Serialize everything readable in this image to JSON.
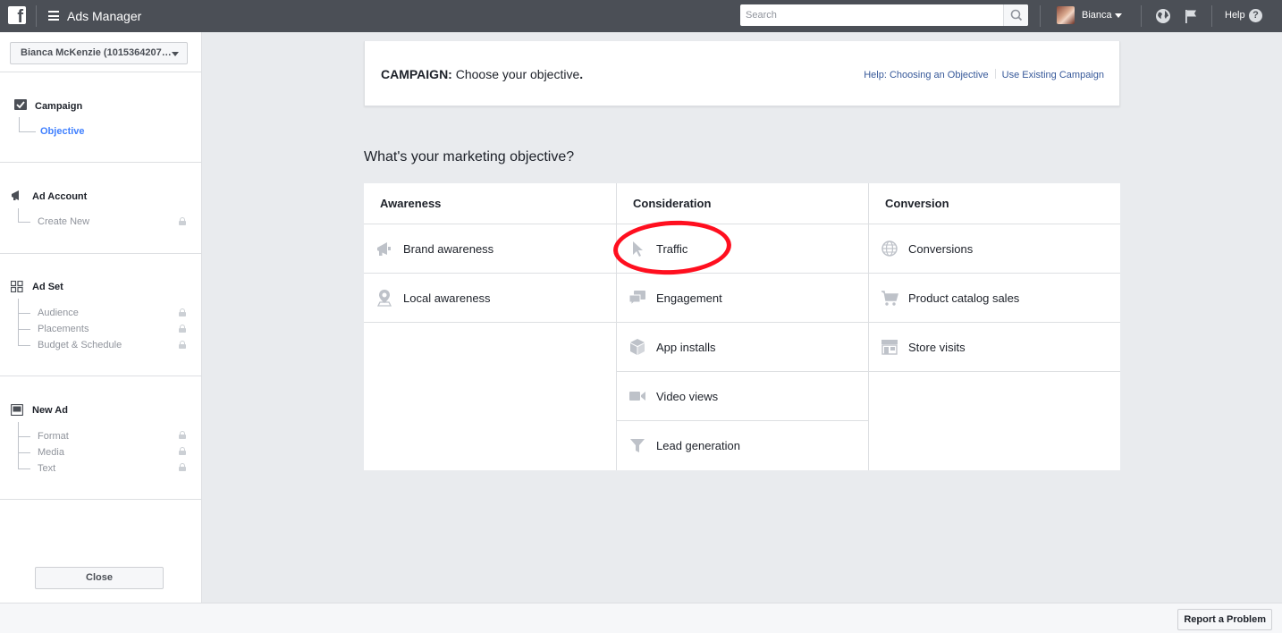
{
  "topbar": {
    "app_title": "Ads Manager",
    "search_placeholder": "Search",
    "user_name": "Bianca",
    "help_label": "Help",
    "help_glyph": "?"
  },
  "sidebar": {
    "account": "Bianca McKenzie (1015364207…",
    "sections": {
      "campaign": {
        "title": "Campaign",
        "items": [
          "Objective"
        ]
      },
      "ad_account": {
        "title": "Ad Account",
        "items": [
          "Create New"
        ]
      },
      "ad_set": {
        "title": "Ad Set",
        "items": [
          "Audience",
          "Placements",
          "Budget & Schedule"
        ]
      },
      "new_ad": {
        "title": "New Ad",
        "items": [
          "Format",
          "Media",
          "Text"
        ]
      }
    },
    "close_label": "Close"
  },
  "campaign_card": {
    "prefix": "CAMPAIGN:",
    "title": "Choose your objective",
    "suffix": ".",
    "links": [
      "Help: Choosing an Objective",
      "Use Existing Campaign"
    ]
  },
  "question": "What's your marketing objective?",
  "objectives": {
    "awareness": {
      "title": "Awareness",
      "items": [
        "Brand awareness",
        "Local awareness"
      ]
    },
    "consideration": {
      "title": "Consideration",
      "items": [
        "Traffic",
        "Engagement",
        "App installs",
        "Video views",
        "Lead generation"
      ]
    },
    "conversion": {
      "title": "Conversion",
      "items": [
        "Conversions",
        "Product catalog sales",
        "Store visits"
      ]
    }
  },
  "icons": {
    "topbar": [
      "facebook-logo-icon",
      "menu-icon",
      "search-icon",
      "globe-icon",
      "flag-icon",
      "help-icon"
    ],
    "objectives": [
      "megaphone-icon",
      "map-pin-icon",
      "cursor-icon",
      "speech-bubbles-icon",
      "box-icon",
      "video-camera-icon",
      "funnel-icon",
      "globe-icon",
      "cart-icon",
      "store-icon"
    ]
  },
  "colors": {
    "topbar": "#4b4f56",
    "link": "#365899",
    "active": "#4080ff",
    "highlight": "#ff0f1f",
    "icon_gray": "#bec2c9"
  },
  "footer": {
    "report_label": "Report a Problem"
  }
}
